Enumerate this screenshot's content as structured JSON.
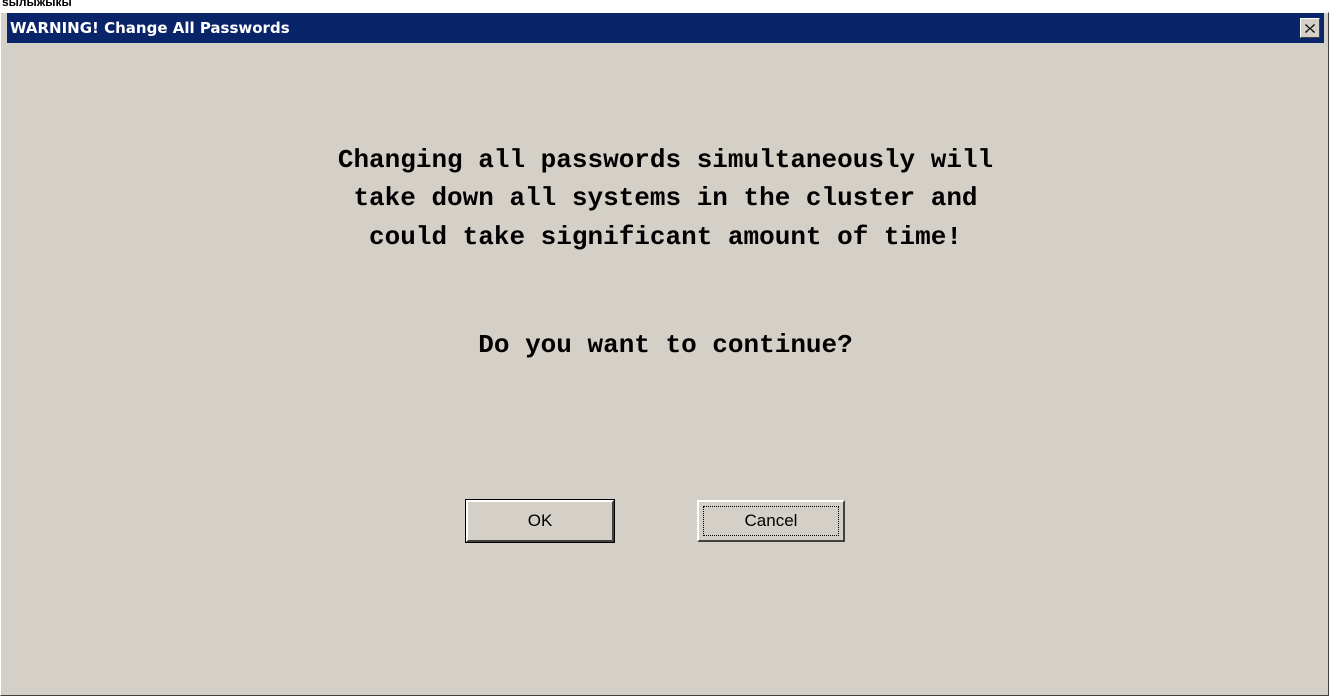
{
  "top_strip": {
    "text": "ѕылыжыкы"
  },
  "window": {
    "title": "WARNING! Change All Passwords",
    "close_icon": "close-icon"
  },
  "message": {
    "lines": [
      "Changing all passwords simultaneously will",
      "take down all systems in the cluster and",
      "could take significant amount of time!"
    ],
    "question": "Do you want to continue?"
  },
  "buttons": {
    "ok_label": "OK",
    "cancel_label": "Cancel"
  },
  "colors": {
    "titlebar": "#0a246a",
    "dialog_background": "#d4d0c8",
    "title_text": "#ffffff"
  }
}
